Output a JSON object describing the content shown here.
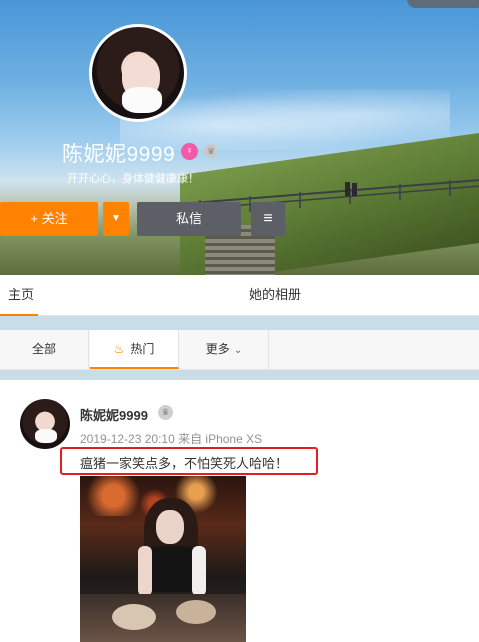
{
  "profile": {
    "top_badge": "",
    "username": "陈妮妮9999",
    "gender_icon": "female-icon",
    "vip_icon": "crown-icon",
    "bio": "开开心心，身体健健康康！"
  },
  "actions": {
    "follow_label": "+ 关注",
    "more_label": "▼",
    "message_label": "私信",
    "menu_label": "≡"
  },
  "tabs": {
    "home": "主页",
    "album": "她的相册"
  },
  "filters": {
    "all": "全部",
    "hot": "热门",
    "more": "更多"
  },
  "post": {
    "author": "陈妮妮9999",
    "meta": "2019-12-23 20:10 来自 iPhone XS",
    "text": "瘟猪一家笑点多，不怕笑死人哈哈！"
  },
  "colors": {
    "accent": "#ff8200",
    "dark_button": "#5c6066",
    "highlight_box": "#e02020"
  }
}
